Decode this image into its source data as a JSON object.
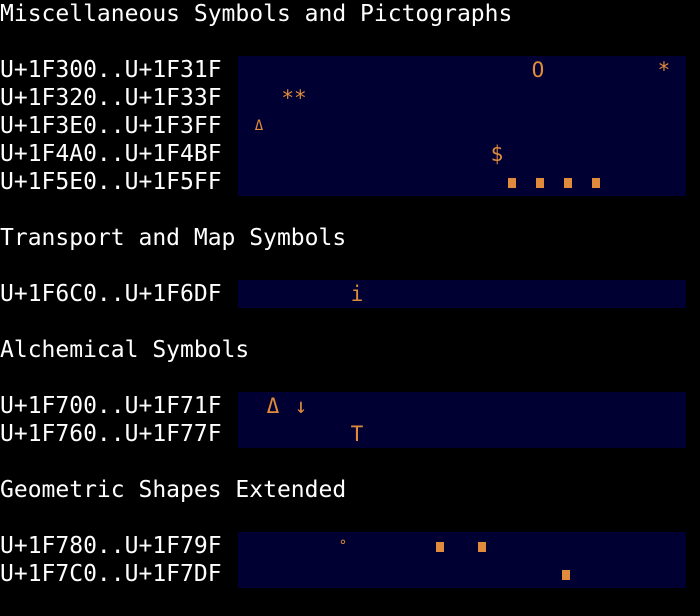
{
  "sections": [
    {
      "heading": "Miscellaneous Symbols and Pictographs",
      "rows": [
        {
          "range": "U+1F300..U+1F31F",
          "glyphs": [
            "O",
            "*"
          ]
        },
        {
          "range": "U+1F320..U+1F33F",
          "glyphs": [
            "**"
          ]
        },
        {
          "range": "U+1F3E0..U+1F3FF",
          "glyphs": [
            "Δ"
          ]
        },
        {
          "range": "U+1F4A0..U+1F4BF",
          "glyphs": [
            "$"
          ]
        },
        {
          "range": "U+1F5E0..U+1F5FF",
          "glyphs": []
        }
      ]
    },
    {
      "heading": "Transport and Map Symbols",
      "rows": [
        {
          "range": "U+1F6C0..U+1F6DF",
          "glyphs": [
            "i"
          ]
        }
      ]
    },
    {
      "heading": "Alchemical Symbols",
      "rows": [
        {
          "range": "U+1F700..U+1F71F",
          "glyphs": [
            "Δ",
            "↓"
          ]
        },
        {
          "range": "U+1F760..U+1F77F",
          "glyphs": [
            "T"
          ]
        }
      ]
    },
    {
      "heading": "Geometric Shapes Extended",
      "rows": [
        {
          "range": "U+1F780..U+1F79F",
          "glyphs": [
            "°"
          ]
        },
        {
          "range": "U+1F7C0..U+1F7DF",
          "glyphs": []
        }
      ]
    }
  ],
  "colors": {
    "background": "#000000",
    "text": "#ffffff",
    "strip": "#000033",
    "glyph": "#e08a3c"
  }
}
